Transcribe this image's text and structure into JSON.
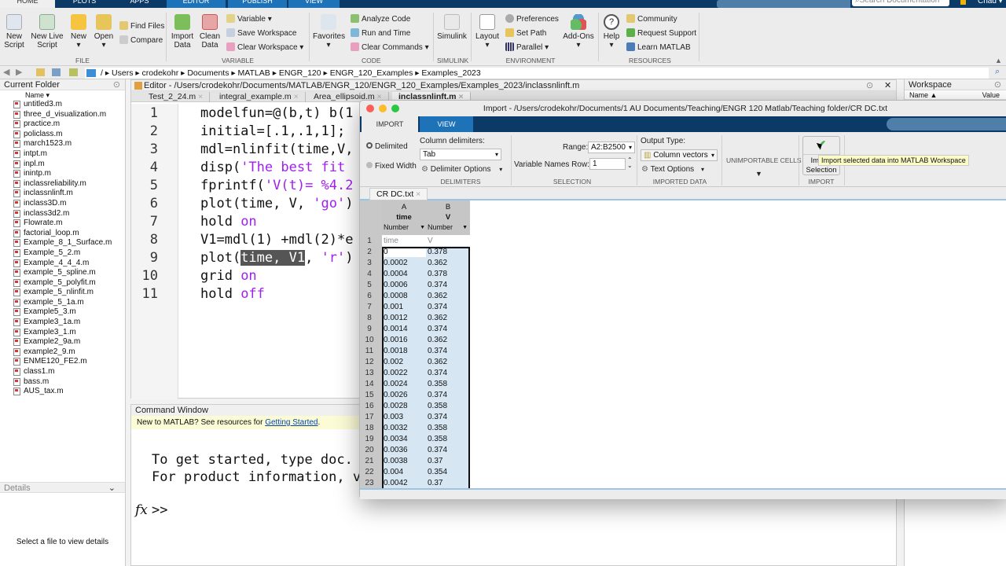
{
  "ribbon_tabs": [
    "HOME",
    "PLOTS",
    "APPS",
    "EDITOR",
    "PUBLISH",
    "VIEW"
  ],
  "search_placeholder": "Search Documentation",
  "user": "Chad",
  "ribbon": {
    "file": {
      "new_script": "New Script",
      "new_live_script": "New Live Script",
      "new": "New",
      "open": "Open",
      "find_files": "Find Files",
      "compare": "Compare",
      "group": "FILE"
    },
    "variable": {
      "import_data": "Import Data",
      "clean_data": "Clean Data",
      "variable": "Variable",
      "save_workspace": "Save Workspace",
      "clear_workspace": "Clear Workspace",
      "group": "VARIABLE"
    },
    "code": {
      "favorites": "Favorites",
      "analyze_code": "Analyze Code",
      "run_and_time": "Run and Time",
      "clear_commands": "Clear Commands",
      "group": "CODE"
    },
    "simulink": {
      "simulink": "Simulink",
      "group": "SIMULINK"
    },
    "environment": {
      "layout": "Layout",
      "preferences": "Preferences",
      "set_path": "Set Path",
      "parallel": "Parallel",
      "add_ons": "Add-Ons",
      "group": "ENVIRONMENT"
    },
    "resources": {
      "help": "Help",
      "community": "Community",
      "request_support": "Request Support",
      "learn_matlab": "Learn MATLAB",
      "group": "RESOURCES"
    }
  },
  "breadcrumb": "/ ▸ Users ▸ crodekohr ▸ Documents ▸ MATLAB ▸ ENGR_120 ▸ ENGR_120_Examples ▸ Examples_2023",
  "current_folder": {
    "title": "Current Folder",
    "name_col": "Name ▾",
    "files": [
      "untitled3.m",
      "three_d_visualization.m",
      "practice.m",
      "policlass.m",
      "march1523.m",
      "intpt.m",
      "inpl.m",
      "inintp.m",
      "inclassreliability.m",
      "inclassnlinft.m",
      "inclass3D.m",
      "inclass3d2.m",
      "Flowrate.m",
      "factorial_loop.m",
      "Example_8_1_Surface.m",
      "Example_5_2.m",
      "Example_4_4_4.m",
      "example_5_spline.m",
      "example_5_polyfit.m",
      "example_5_nlinfit.m",
      "example_5_1a.m",
      "Example5_3.m",
      "Example3_1a.m",
      "Example3_1.m",
      "Example2_9a.m",
      "example2_9.m",
      "ENME120_FE2.m",
      "class1.m",
      "bass.m",
      "AUS_tax.m"
    ]
  },
  "details": {
    "title": "Details",
    "empty": "Select a file to view details"
  },
  "editor": {
    "title": "Editor - /Users/crodekohr/Documents/MATLAB/ENGR_120/ENGR_120_Examples/Examples_2023/inclassnlinft.m",
    "tabs": [
      "Test_2_24.m",
      "integral_example.m",
      "Area_ellipsoid.m",
      "inclassnlinft.m"
    ],
    "active_tab": "inclassnlinft.m",
    "lines": [
      "modelfun=@(b,t) b(1",
      "initial=[.1,.1,1];",
      "mdl=nlinfit(time,V,",
      "disp('The best fit ",
      "fprintf('V(t)= %4.2",
      "plot(time, V, 'go')",
      "hold on",
      "V1=mdl(1) +mdl(2)*e",
      "plot(time, V1, 'r')",
      "grid on",
      "hold off"
    ]
  },
  "command_window": {
    "title": "Command Window",
    "banner_text": "New to MATLAB? See resources for ",
    "banner_link": "Getting Started",
    "line1": "To get started, type doc.",
    "line2": "For product information, v",
    "prompt": ">>"
  },
  "workspace": {
    "title": "Workspace",
    "col_name": "Name ▲",
    "col_value": "Value"
  },
  "import_dialog": {
    "title": "Import - /Users/crodekohr/Documents/1 AU Documents/Teaching/ENGR 120 Matlab/Teaching folder/CR DC.txt",
    "tabs": [
      "IMPORT",
      "VIEW"
    ],
    "delimited": "Delimited",
    "fixed_width": "Fixed Width",
    "column_delimiters_label": "Column delimiters:",
    "column_delimiter_value": "Tab",
    "delimiter_options": "Delimiter Options",
    "group_delimiters": "DELIMITERS",
    "range_label": "Range:",
    "range_value": "A2:B2500",
    "var_names_row_label": "Variable Names Row:",
    "var_names_row_value": "1",
    "group_selection": "SELECTION",
    "output_type_label": "Output Type:",
    "output_type_value": "Column vectors",
    "text_options": "Text Options",
    "group_imported": "IMPORTED DATA",
    "unimportable": "UNIMPORTABLE CELLS",
    "import_selection": "Import Selection",
    "group_import": "IMPORT",
    "tooltip": "Import selected data into MATLAB Workspace",
    "file_tab": "CR DC.txt",
    "columns": [
      {
        "letter": "A",
        "name": "time",
        "type": "Number"
      },
      {
        "letter": "B",
        "name": "V",
        "type": "Number"
      }
    ],
    "header_row": [
      "time",
      "V"
    ],
    "rows": [
      [
        "0",
        "0.378"
      ],
      [
        "0.0002",
        "0.362"
      ],
      [
        "0.0004",
        "0.378"
      ],
      [
        "0.0006",
        "0.374"
      ],
      [
        "0.0008",
        "0.362"
      ],
      [
        "0.001",
        "0.374"
      ],
      [
        "0.0012",
        "0.362"
      ],
      [
        "0.0014",
        "0.374"
      ],
      [
        "0.0016",
        "0.362"
      ],
      [
        "0.0018",
        "0.374"
      ],
      [
        "0.002",
        "0.362"
      ],
      [
        "0.0022",
        "0.374"
      ],
      [
        "0.0024",
        "0.358"
      ],
      [
        "0.0026",
        "0.374"
      ],
      [
        "0.0028",
        "0.358"
      ],
      [
        "0.003",
        "0.374"
      ],
      [
        "0.0032",
        "0.358"
      ],
      [
        "0.0034",
        "0.358"
      ],
      [
        "0.0036",
        "0.374"
      ],
      [
        "0.0038",
        "0.37"
      ],
      [
        "0.004",
        "0.354"
      ],
      [
        "0.0042",
        "0.37"
      ]
    ]
  }
}
